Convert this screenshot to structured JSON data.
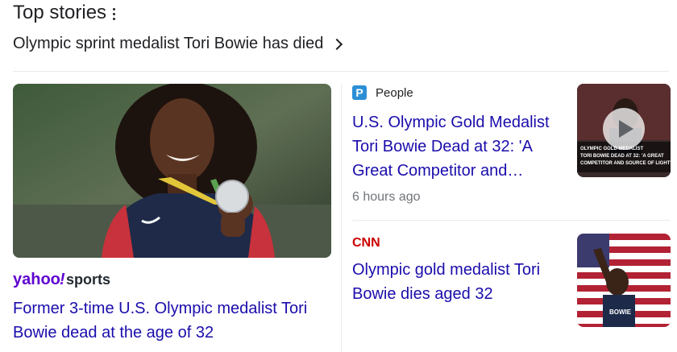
{
  "header": {
    "title": "Top stories"
  },
  "topic": {
    "label": "Olympic sprint medalist Tori Bowie has died"
  },
  "big_story": {
    "source": "yahoo!sports",
    "title": "Former 3-time U.S. Olympic medalist Tori Bowie dead at the age of 32"
  },
  "stories": [
    {
      "source_badge": "P",
      "source": "People",
      "title": "U.S. Olympic Gold Medalist Tori Bowie Dead at 32: 'A Great Competitor and…",
      "time": "6 hours ago",
      "thumb_caption": "OLYMPIC GOLD MEDALIST TORI BOWIE DEAD AT 32: 'A GREAT COMPETITOR AND SOURCE OF LIGHT'"
    },
    {
      "source": "CNN",
      "title": "Olympic gold medalist Tori Bowie dies aged 32",
      "thumb_caption": "BOWIE"
    }
  ],
  "colors": {
    "link": "#1a0dab",
    "divider": "#e8eaed",
    "cnn": "#cc0000",
    "people": "#2c8fd6"
  }
}
